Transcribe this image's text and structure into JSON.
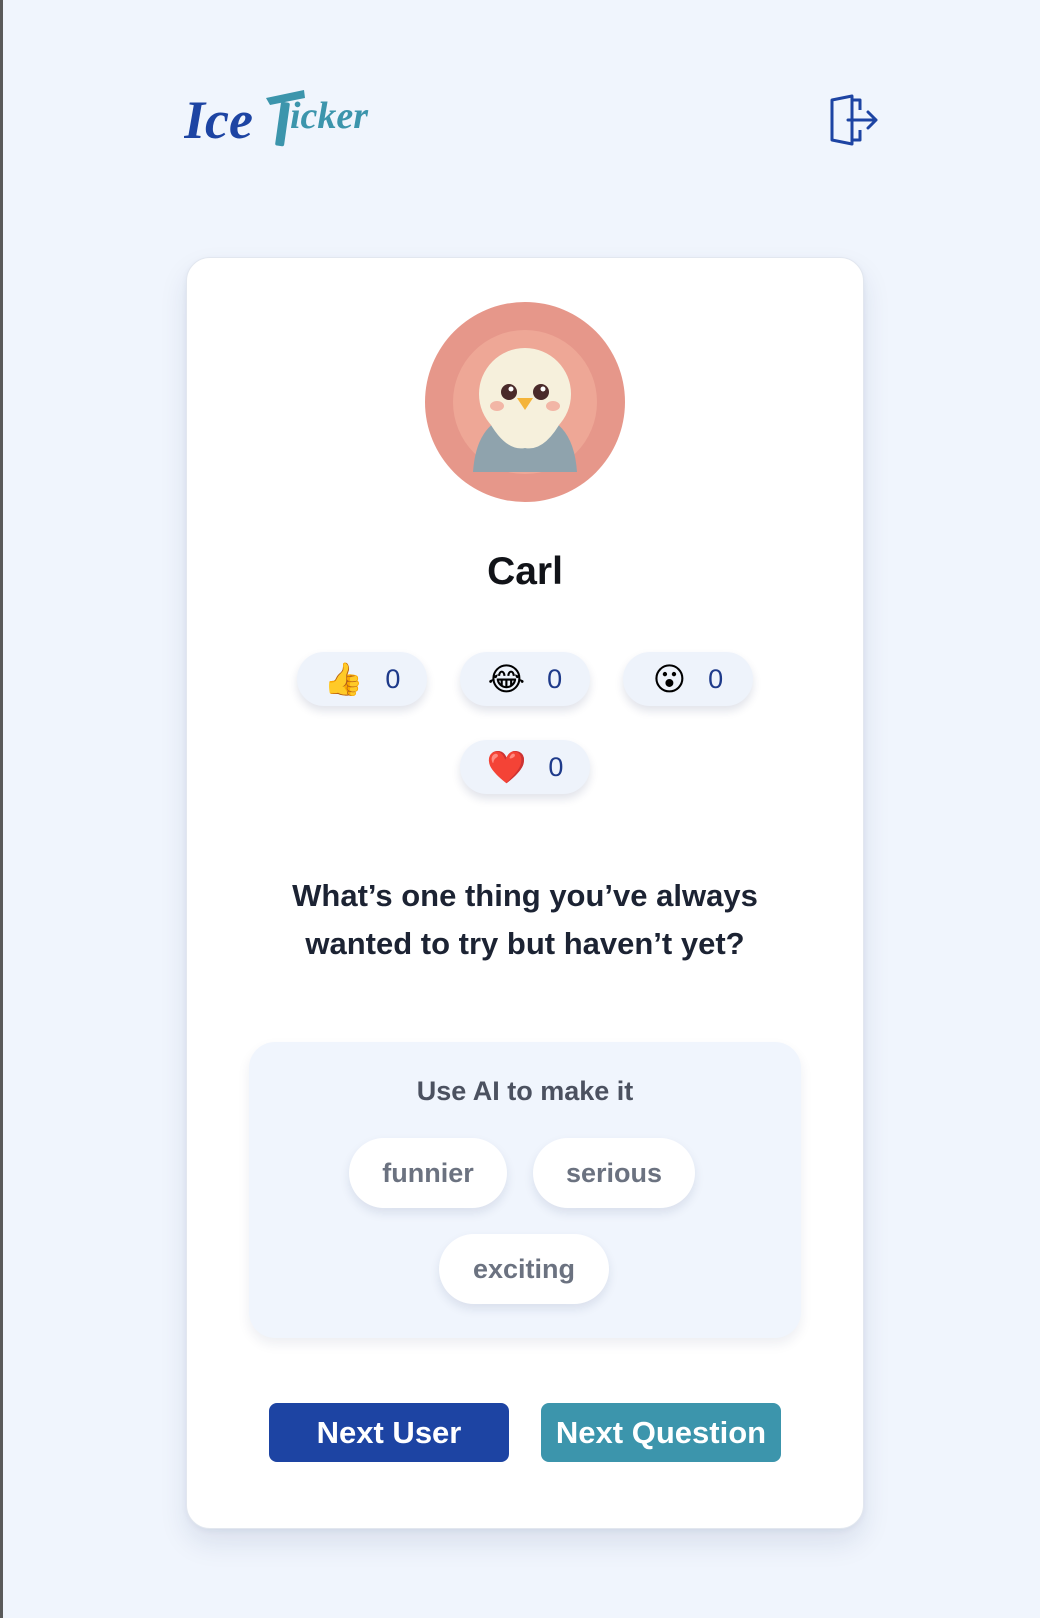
{
  "brand": {
    "logo_text": "IceTicker",
    "logo_part1": "Ice",
    "logo_part2": "icker"
  },
  "header": {
    "logout_icon": "logout-icon"
  },
  "profile": {
    "name": "Carl",
    "avatar_icon": "bird-avatar"
  },
  "reactions": [
    {
      "emoji": "👍",
      "count": "0",
      "icon": "thumbs-up-icon"
    },
    {
      "emoji": "😂",
      "count": "0",
      "icon": "laughing-icon"
    },
    {
      "emoji": "😮",
      "count": "0",
      "icon": "surprised-icon"
    },
    {
      "emoji": "❤️",
      "count": "0",
      "icon": "heart-icon"
    }
  ],
  "question": {
    "text": "What’s one thing you’ve always wanted to try but haven’t yet?"
  },
  "ai": {
    "title": "Use AI to make it",
    "options": [
      "funnier",
      "serious",
      "exciting"
    ]
  },
  "actions": {
    "next_user": "Next User",
    "next_question": "Next Question"
  },
  "colors": {
    "background": "#f0f5fd",
    "primary": "#1d44a3",
    "secondary": "#3c95ac",
    "text": "#111318"
  }
}
